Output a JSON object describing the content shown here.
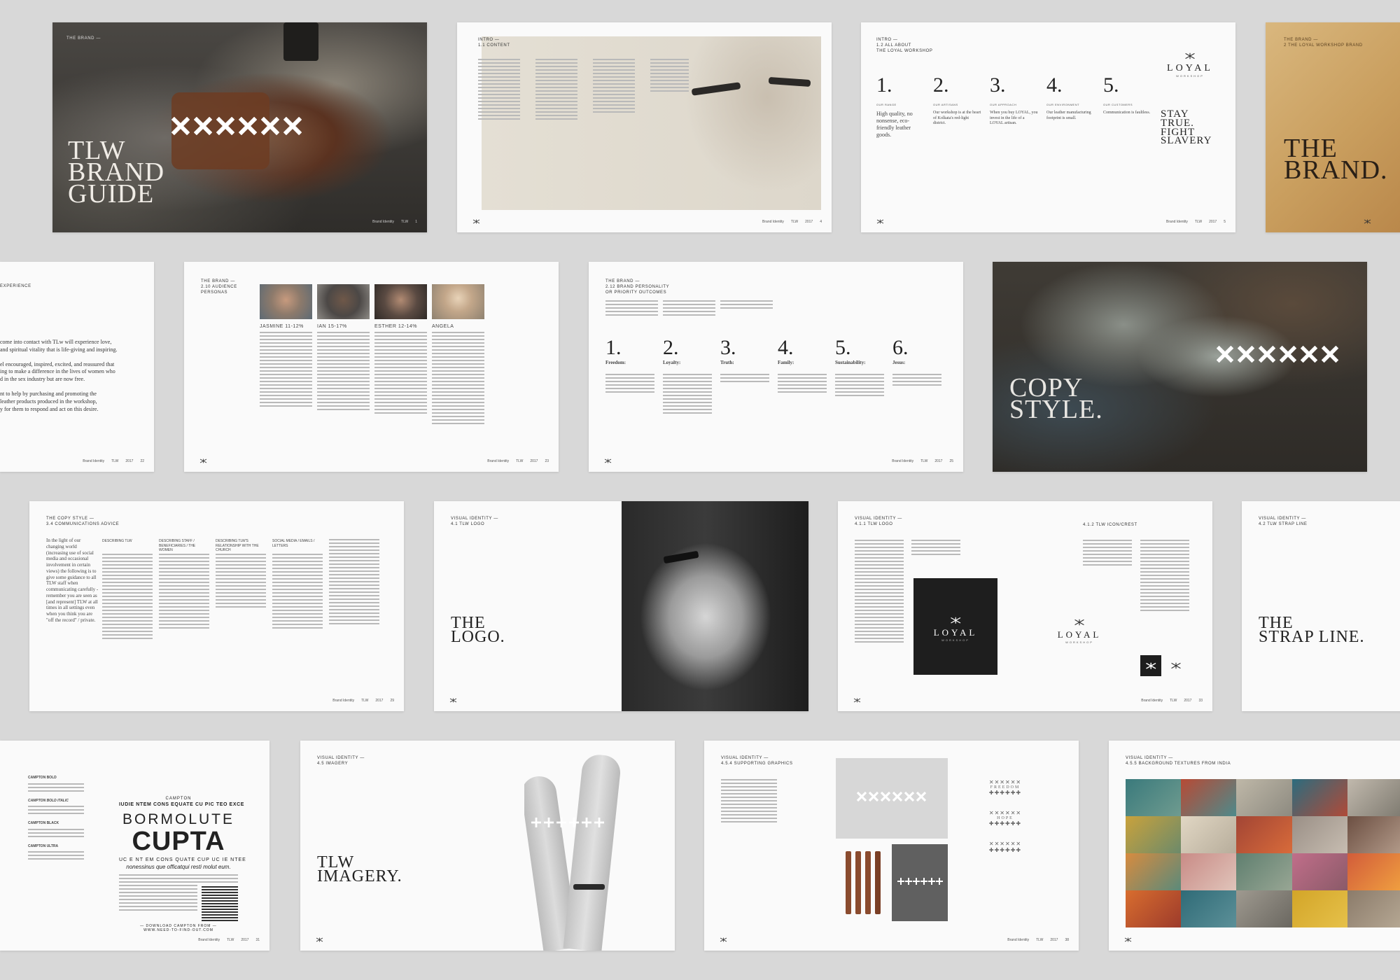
{
  "colors": {
    "background": "#d8d8d8",
    "page": "#fafafa",
    "ink": "#222222",
    "dark_box": "#1e1e1e",
    "grey_box": "#606060",
    "leather": "#8a4b2e"
  },
  "icons": [
    "tlw-logo-mark-icon",
    "cross-mark-icon",
    "plus-mark-icon"
  ],
  "spreads": {
    "cover": {
      "section": "THE BRAND —",
      "title": [
        "TLW",
        "BRAND",
        "GUIDE"
      ],
      "footer": [
        "Brand Identity",
        "TLW",
        "1"
      ]
    },
    "contents": {
      "section": "INTRO —",
      "heading": "1.1 CONTENT",
      "footer": [
        "Brand Identity",
        "TLW",
        "2017",
        "4"
      ]
    },
    "workshop": {
      "section": "INTRO —",
      "heading": [
        "1.2 ALL ABOUT",
        "THE LOYAL WORKSHOP"
      ],
      "columns": [
        {
          "num": "1.",
          "head": "OUR RANGE",
          "text": "High quality, no nonsense, eco-friendly leather goods."
        },
        {
          "num": "2.",
          "head": "OUR ARTISANS",
          "text": "Our workshop is at the heart of Kolkata's red-light district."
        },
        {
          "num": "3.",
          "head": "OUR APPROACH",
          "text": "When you buy LOYAL, you invest in the life of a LOYAL artisan."
        },
        {
          "num": "4.",
          "head": "OUR ENVIRONMENT",
          "text": "Our leather manufacturing footprint is small."
        },
        {
          "num": "5.",
          "head": "OUR CUSTOMERS",
          "text": "Communication is faultless."
        }
      ],
      "logo": {
        "word": "LOYAL",
        "sub": "WORKSHOP"
      },
      "tagline": [
        "STAY",
        "TRUE.",
        "FIGHT",
        "SLAVERY"
      ],
      "footer": [
        "Brand Identity",
        "TLW",
        "2017",
        "5"
      ]
    },
    "the_brand": {
      "section": "THE BRAND —",
      "heading": "2 THE LOYAL WORKSHOP BRAND",
      "title": [
        "THE",
        "BRAND."
      ]
    },
    "experience": {
      "section": "EXPERIENCE",
      "lines": [
        "come into contact with TLw will experience love,",
        "and spiritual vitality that is life-giving and inspiring.",
        "el encouraged, inspired, excited, and reassured that",
        "ing to make a difference in the lives of women who",
        "d in the sex industry but are now free.",
        "nt to help by purchasing and promoting the",
        "leather products produced in the workshop,",
        "y for them to respond and act on this desire."
      ],
      "footer": [
        "Brand Identity",
        "TLW",
        "2017",
        "22"
      ]
    },
    "personas": {
      "section": "THE BRAND —",
      "heading": [
        "2.10 AUDIENCE",
        "PERSONAS"
      ],
      "people": [
        {
          "name": "JASMINE",
          "pct": "11-12%"
        },
        {
          "name": "IAN",
          "pct": "15-17%"
        },
        {
          "name": "ESTHER",
          "pct": "12-14%"
        },
        {
          "name": "ANGELA",
          "pct": ""
        }
      ],
      "footer": [
        "Brand Identity",
        "TLW",
        "2017",
        "23"
      ]
    },
    "personality": {
      "section": "THE BRAND —",
      "heading": [
        "2.12 BRAND PERSONALITY",
        "OR PRIORITY OUTCOMES"
      ],
      "values": [
        {
          "num": "1.",
          "word": "Freedom:"
        },
        {
          "num": "2.",
          "word": "Loyalty:"
        },
        {
          "num": "3.",
          "word": "Truth:"
        },
        {
          "num": "4.",
          "word": "Family:"
        },
        {
          "num": "5.",
          "word": "Sustainability:"
        },
        {
          "num": "6.",
          "word": "Jesus:"
        }
      ],
      "footer": [
        "Brand Identity",
        "TLW",
        "2017",
        "25"
      ]
    },
    "copy_style": {
      "title": [
        "COPY",
        "STYLE."
      ]
    },
    "comms": {
      "section": "THE COPY STYLE —",
      "heading": "3.4 COMMUNICATIONS ADVICE",
      "intro": "In the light of our changing world (increasing use of social media and occasional involvement in certain views) the following is to give some guidance to all TLW staff when communicating carefully - remember you are seen as [and represent] TLW at all times in all settings even when you think you are \"off the record\" / private.",
      "col_heads": [
        "DESCRIBING TLW",
        "DESCRIBING STAFF / BENEFICIARIES / THE WOMEN",
        "DESCRIBING TLW'S RELATIONSHIP WITH THE CHURCH",
        "SOCIAL MEDIA / EMAILS / LETTERS"
      ],
      "footer": [
        "Brand Identity",
        "TLW",
        "2017",
        "29"
      ]
    },
    "logo": {
      "section": "VISUAL IDENTITY —",
      "heading": "4.1 TLW LOGO",
      "title": [
        "THE",
        "LOGO."
      ]
    },
    "iconcrest": {
      "section": "VISUAL IDENTITY —",
      "heading": "4.1.1 TLW LOGO",
      "heading2": "4.1.2 TLW ICON/CREST",
      "logo": {
        "word": "LOYAL",
        "sub": "WORKSHOP"
      },
      "footer": [
        "Brand Identity",
        "TLW",
        "2017",
        "33"
      ]
    },
    "strapline": {
      "section": "VISUAL IDENTITY —",
      "heading": "4.2 TLW STRAP LINE",
      "title": [
        "THE",
        "STRAP LINE."
      ]
    },
    "type": {
      "kicker": "CAMPTON",
      "line1": "IUDIE NTEM CONS EQUATE CU PIC TEO EXCE",
      "big1": "BORMOLUTE",
      "big2": "CUPTA",
      "line2": "UC E NT EM CONS QUATE CUP UC IE NTEE",
      "italic": "nonessinus que officatqui resti molut eum.",
      "download": "— DOWNLOAD CAMPTON FROM —",
      "url": "WWW.NEED-TO-FIND-OUT.COM",
      "weights": [
        "CAMPTON BOLD",
        "CAMPTON BOLD ITALIC",
        "CAMPTON BLACK",
        "CAMPTON ULTRA"
      ],
      "footer": [
        "Brand Identity",
        "TLW",
        "2017",
        "31"
      ]
    },
    "imagery": {
      "section": "VISUAL IDENTITY —",
      "heading": "4.5 IMAGERY",
      "title": [
        "TLW",
        "IMAGERY."
      ]
    },
    "graphics": {
      "section": "VISUAL IDENTITY —",
      "heading": "4.5.4 SUPPORTING GRAPHICS",
      "words": [
        "FREEDOM",
        "HOPE"
      ],
      "footer": [
        "Brand Identity",
        "TLW",
        "2017",
        "38"
      ]
    },
    "textures": {
      "section": "VISUAL IDENTITY —",
      "heading": "4.5.5 BACKGROUND TEXTURES FROM INDIA"
    }
  }
}
